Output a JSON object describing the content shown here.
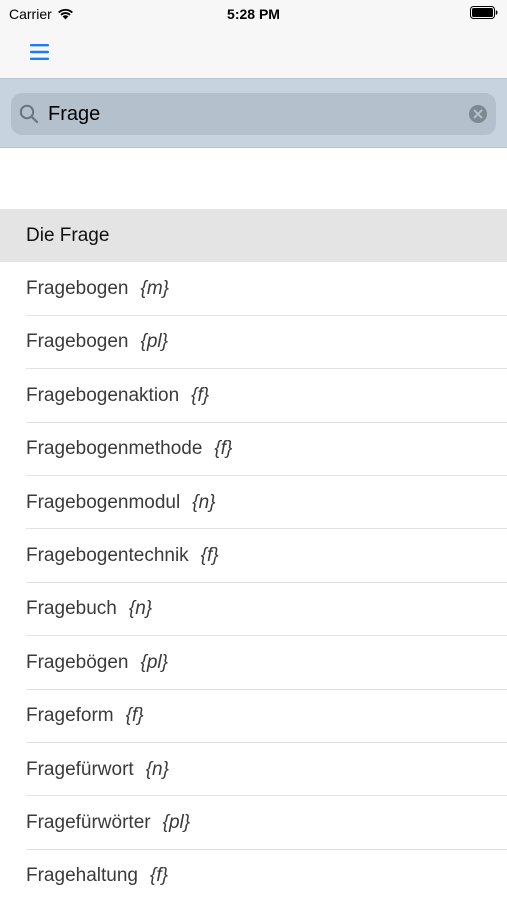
{
  "status_bar": {
    "carrier": "Carrier",
    "time": "5:28 PM"
  },
  "search": {
    "value": "Frage",
    "placeholder": ""
  },
  "results": {
    "header": "Die Frage",
    "items": [
      {
        "word": "Fragebogen",
        "gender": "{m}"
      },
      {
        "word": "Fragebogen",
        "gender": "{pl}"
      },
      {
        "word": "Fragebogenaktion",
        "gender": "{f}"
      },
      {
        "word": "Fragebogenmethode",
        "gender": "{f}"
      },
      {
        "word": "Fragebogenmodul",
        "gender": "{n}"
      },
      {
        "word": "Fragebogentechnik",
        "gender": "{f}"
      },
      {
        "word": "Fragebuch",
        "gender": "{n}"
      },
      {
        "word": "Fragebögen",
        "gender": "{pl}"
      },
      {
        "word": "Frageform",
        "gender": "{f}"
      },
      {
        "word": "Fragefürwort",
        "gender": "{n}"
      },
      {
        "word": "Fragefürwörter",
        "gender": "{pl}"
      },
      {
        "word": "Fragehaltung",
        "gender": "{f}"
      }
    ]
  },
  "colors": {
    "accent": "#1a7df1",
    "search_bar_bg": "#c7d3df",
    "header_row_bg": "#e4e4e4"
  },
  "icons": [
    "wifi-icon",
    "battery-icon",
    "menu-icon",
    "search-icon",
    "clear-icon"
  ]
}
